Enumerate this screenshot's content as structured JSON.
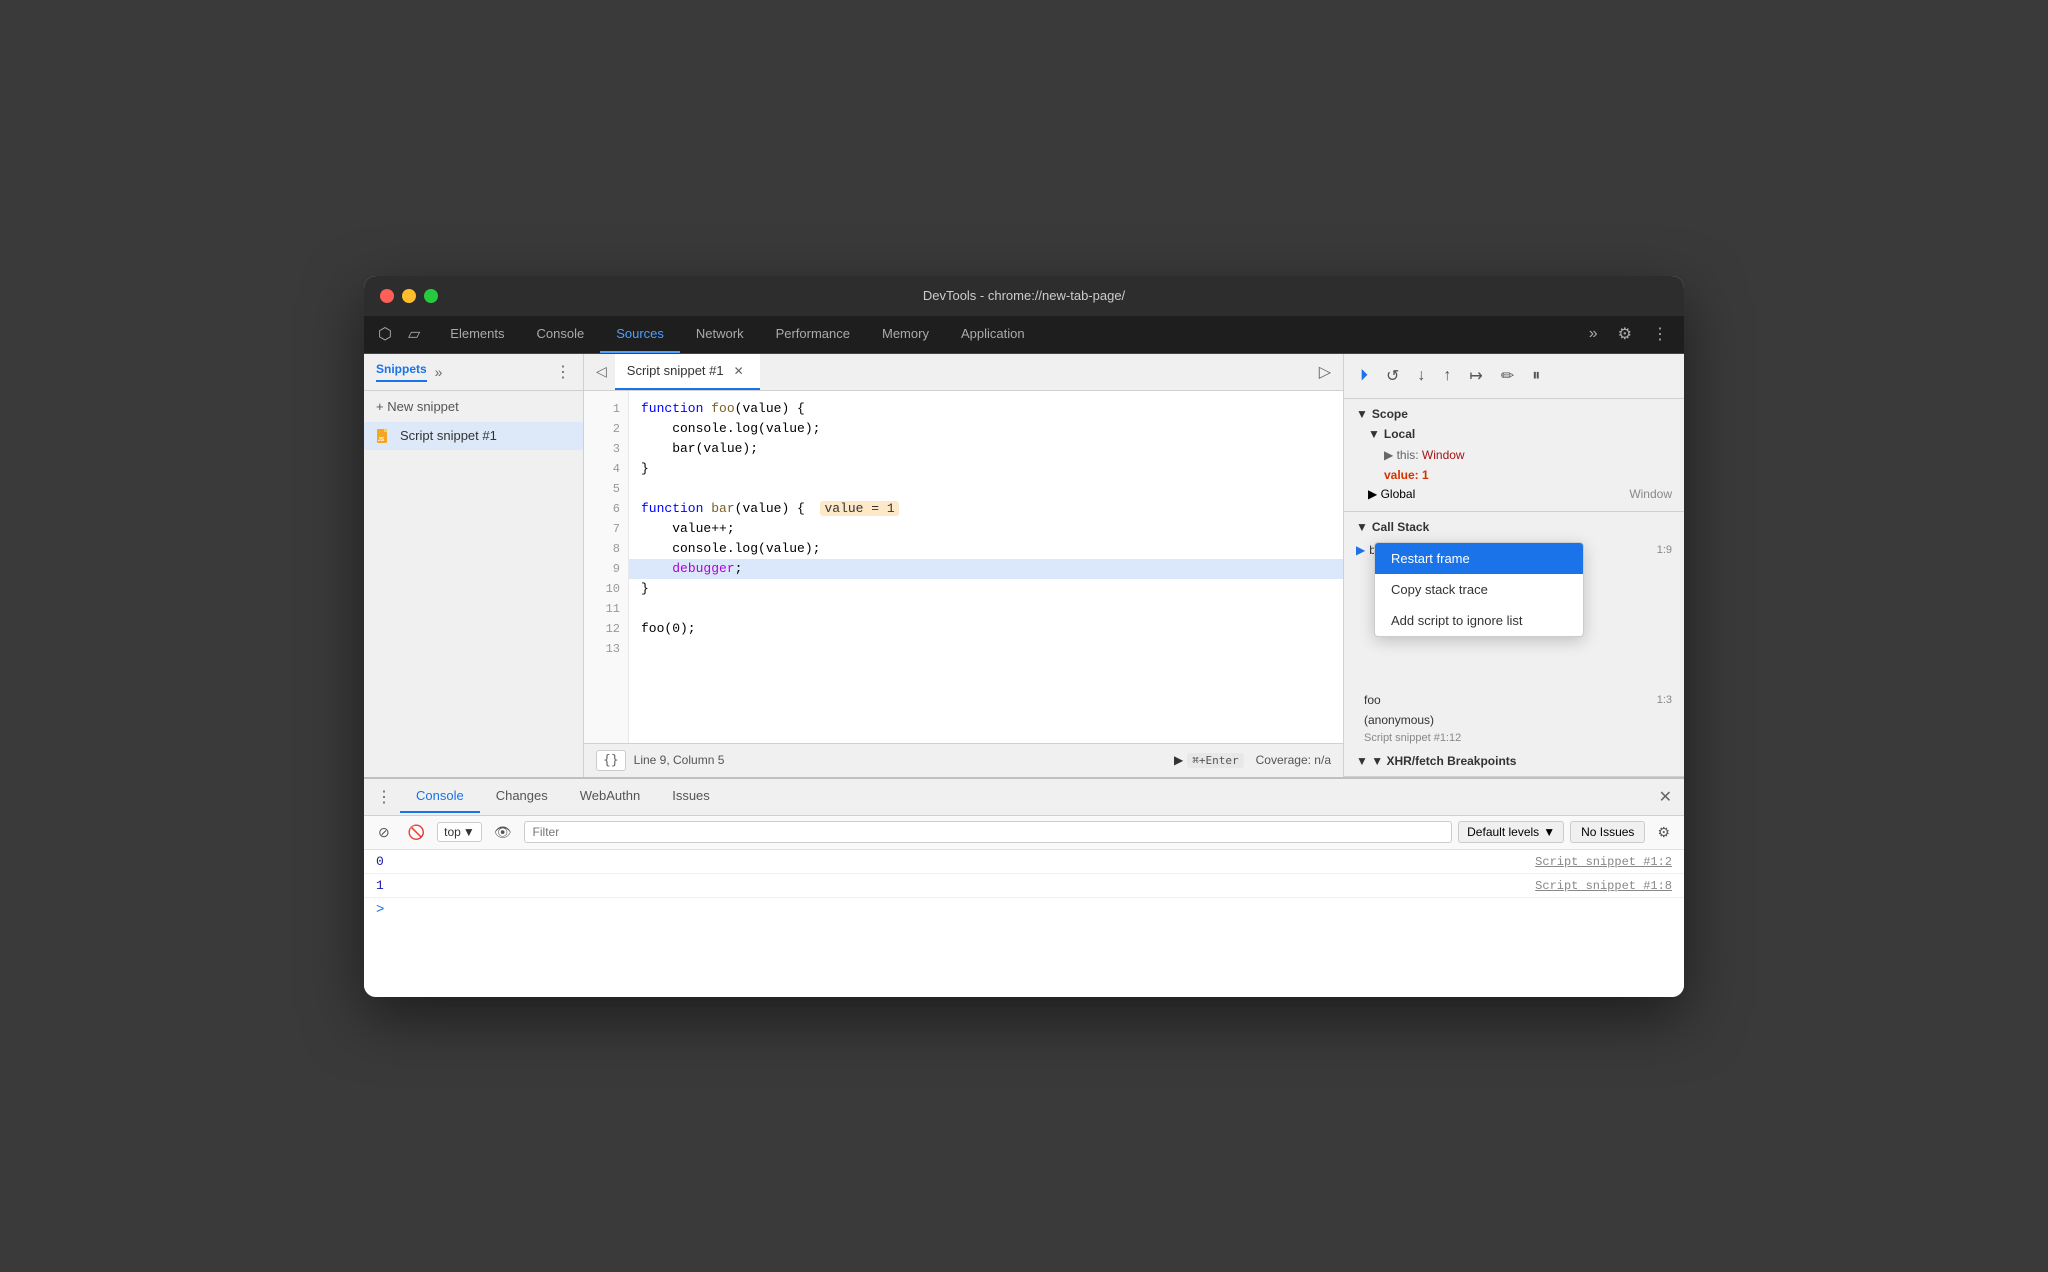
{
  "titleBar": {
    "title": "DevTools - chrome://new-tab-page/"
  },
  "tabs": {
    "items": [
      {
        "label": "Elements",
        "active": false
      },
      {
        "label": "Console",
        "active": false
      },
      {
        "label": "Sources",
        "active": true
      },
      {
        "label": "Network",
        "active": false
      },
      {
        "label": "Performance",
        "active": false
      },
      {
        "label": "Memory",
        "active": false
      },
      {
        "label": "Application",
        "active": false
      }
    ]
  },
  "sidebar": {
    "tabLabel": "Snippets",
    "newSnippetLabel": "+ New snippet",
    "snippetName": "Script snippet #1"
  },
  "editor": {
    "tabLabel": "Script snippet #1",
    "lines": [
      {
        "num": "1",
        "code": "function foo(value) {",
        "highlighted": false
      },
      {
        "num": "2",
        "code": "    console.log(value);",
        "highlighted": false
      },
      {
        "num": "3",
        "code": "    bar(value);",
        "highlighted": false
      },
      {
        "num": "4",
        "code": "}",
        "highlighted": false
      },
      {
        "num": "5",
        "code": "",
        "highlighted": false
      },
      {
        "num": "6",
        "code": "function bar(value) {    value = 1",
        "highlighted": false,
        "hasValueHighlight": true
      },
      {
        "num": "7",
        "code": "    value++;",
        "highlighted": false
      },
      {
        "num": "8",
        "code": "    console.log(value);",
        "highlighted": false
      },
      {
        "num": "9",
        "code": "    debugger;",
        "highlighted": true
      },
      {
        "num": "10",
        "code": "}",
        "highlighted": false
      },
      {
        "num": "11",
        "code": "",
        "highlighted": false
      },
      {
        "num": "12",
        "code": "foo(0);",
        "highlighted": false
      },
      {
        "num": "13",
        "code": "",
        "highlighted": false
      }
    ],
    "statusLine": "Line 9, Column 5",
    "coverageLabel": "Coverage: n/a",
    "runLabel": "⌘+Enter"
  },
  "debugger": {
    "scope": {
      "sectionLabel": "▼ Scope",
      "localLabel": "▼ Local",
      "thisLabel": "this:",
      "thisValue": "Window",
      "valueLabel": "value:",
      "valueNum": "1",
      "globalLabel": "▶ Global",
      "globalValue": "Window"
    },
    "callStack": {
      "sectionLabel": "▼ Call Stack",
      "frames": [
        {
          "name": "bar",
          "loc": "1:9"
        },
        {
          "name": "foo",
          "loc": "1:3"
        },
        {
          "name": "(anonymous)",
          "loc": ""
        }
      ],
      "scriptRef": "Script snippet #1:12"
    },
    "xhrLabel": "▼ XHR/fetch Breakpoints"
  },
  "contextMenu": {
    "items": [
      {
        "label": "Restart frame",
        "active": true
      },
      {
        "label": "Copy stack trace",
        "active": false
      },
      {
        "label": "Add script to ignore list",
        "active": false
      }
    ]
  },
  "bottomPanel": {
    "tabs": [
      {
        "label": "Console",
        "active": true
      },
      {
        "label": "Changes",
        "active": false
      },
      {
        "label": "WebAuthn",
        "active": false
      },
      {
        "label": "Issues",
        "active": false
      }
    ],
    "toolbar": {
      "topLabel": "top",
      "filterPlaceholder": "Filter",
      "defaultLevelsLabel": "Default levels",
      "noIssuesLabel": "No Issues"
    },
    "logs": [
      {
        "value": "0",
        "source": "Script snippet #1:2"
      },
      {
        "value": "1",
        "source": "Script snippet #1:8"
      }
    ]
  }
}
